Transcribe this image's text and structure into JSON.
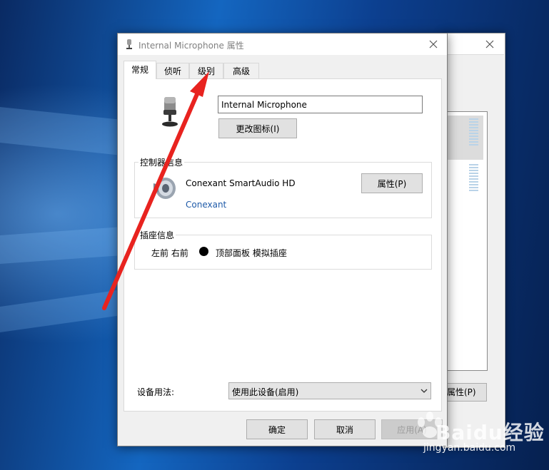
{
  "dialog": {
    "title": "Internal Microphone 属性",
    "tabs": [
      {
        "label": "常规",
        "active": true
      },
      {
        "label": "侦听",
        "active": false
      },
      {
        "label": "级别",
        "active": false
      },
      {
        "label": "高级",
        "active": false
      }
    ],
    "device_name_value": "Internal Microphone",
    "change_icon_label": "更改图标(I)",
    "controller": {
      "group_label": "控制器信息",
      "name": "Conexant SmartAudio HD",
      "vendor": "Conexant",
      "properties_label": "属性(P)"
    },
    "jack": {
      "group_label": "插座信息",
      "position": "左前 右前",
      "location": "顶部面板 模拟插座"
    },
    "usage": {
      "label": "设备用法:",
      "selected": "使用此设备(启用)"
    },
    "buttons": {
      "ok": "确定",
      "cancel": "取消",
      "apply": "应用(A)"
    }
  },
  "background_window": {
    "button_label_fragment": "属性(P)"
  },
  "watermark": {
    "brand": "Baidu经验",
    "url": "jingyan.baidu.com"
  },
  "colors": {
    "annotation_arrow": "#e8231f",
    "desktop_blue": "#1466c0",
    "link": "#1e5aa8"
  },
  "icons": [
    "microphone-icon",
    "speaker-icon",
    "close-icon",
    "chevron-down-icon",
    "jack-dot-icon"
  ]
}
